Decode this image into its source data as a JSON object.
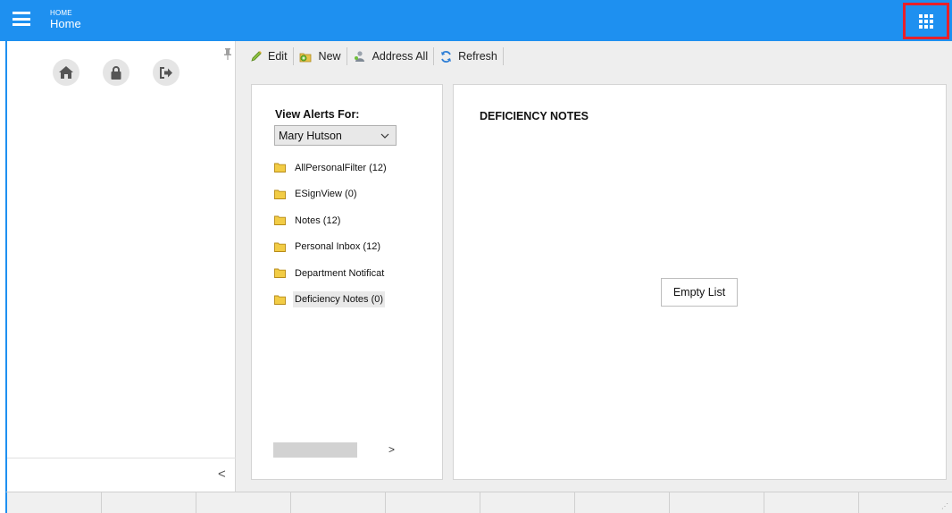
{
  "header": {
    "section_label": "HOME",
    "title": "Home",
    "brand_color": "#1e90f0",
    "menu_icon": "hamburger-icon",
    "apps_icon": "apps-grid-icon",
    "highlight_color": "#e8202a"
  },
  "sidebar": {
    "icons": [
      "home-icon",
      "lock-icon",
      "logout-icon"
    ],
    "pin_icon": "pin-icon",
    "collapse_label": "<"
  },
  "toolbar": {
    "edit_label": "Edit",
    "new_label": "New",
    "address_all_label": "Address All",
    "refresh_label": "Refresh"
  },
  "alerts": {
    "view_for_label": "View Alerts For:",
    "selected_user": "Mary Hutson",
    "folders": [
      {
        "label": "AllPersonalFilter (12)"
      },
      {
        "label": "ESignView (0)"
      },
      {
        "label": "Notes (12)"
      },
      {
        "label": "Personal Inbox (12)"
      },
      {
        "label": "Department Notificat"
      },
      {
        "label": "Deficiency Notes (0)"
      }
    ],
    "selected_folder": "Deficiency Notes (0)",
    "scroll_arrow": ">"
  },
  "detail": {
    "title": "DEFICIENCY NOTES",
    "empty_text": "Empty List"
  }
}
